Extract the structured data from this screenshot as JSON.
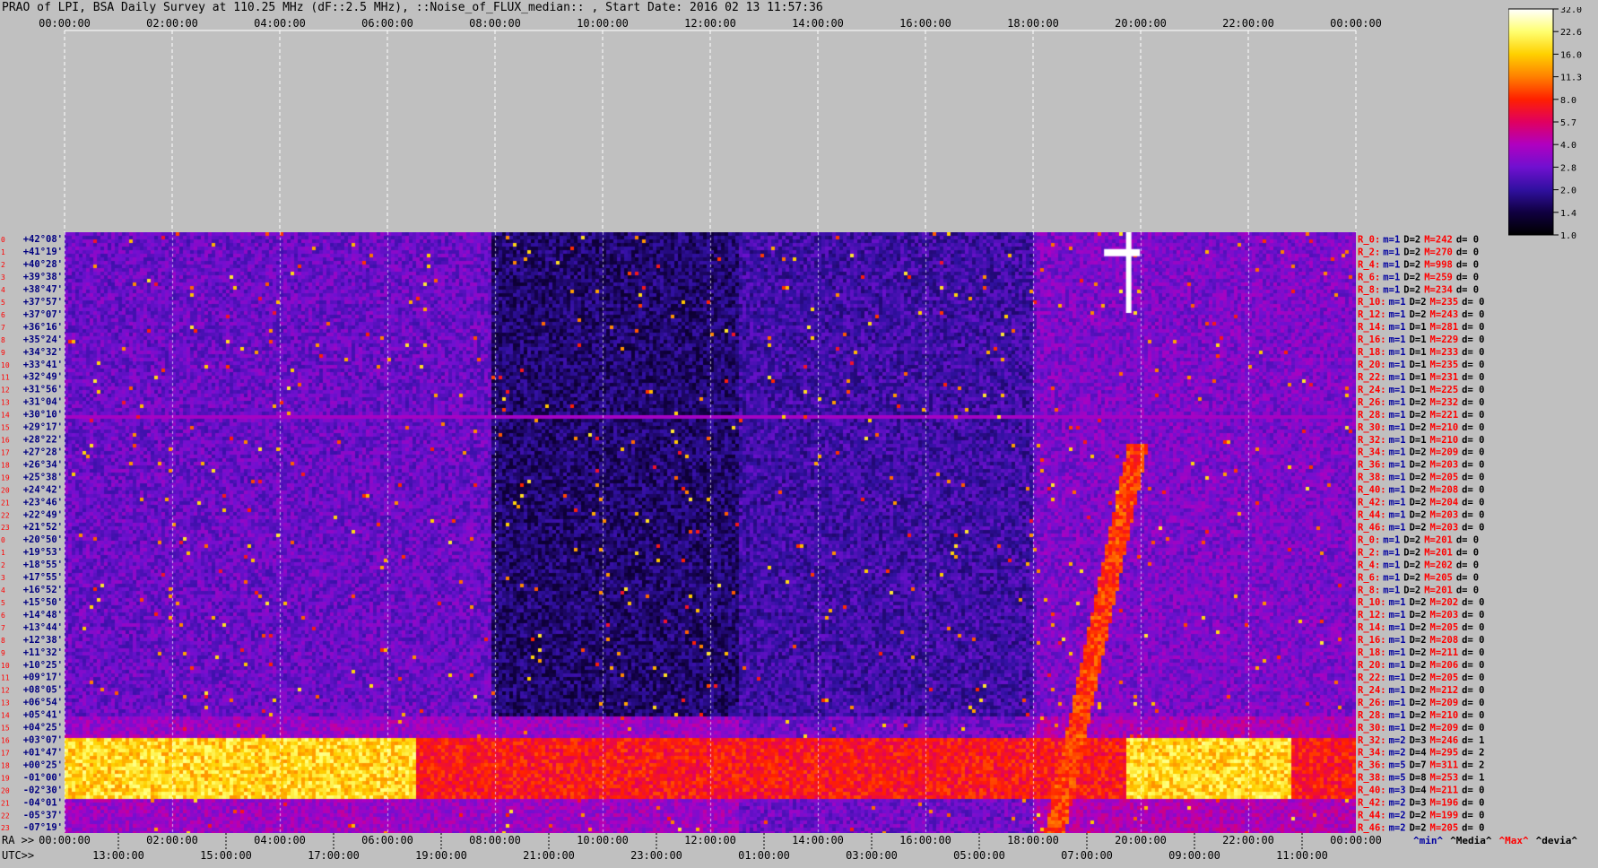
{
  "title": "PRAO of LPI, BSA Daily Survey at 110.25 MHz (dF::2.5 MHz), ::Noise_of_FLUX_median:: , Start Date: 2016 02 13 11:57:36",
  "chart_data": {
    "type": "heatmap",
    "title": "PRAO of LPI, BSA Daily Survey at 110.25 MHz (dF::2.5 MHz), ::Noise_of_FLUX_median:: , Start Date: 2016 02 13 11:57:36",
    "x_top_ticks": [
      "00:00:00",
      "02:00:00",
      "04:00:00",
      "06:00:00",
      "08:00:00",
      "10:00:00",
      "12:00:00",
      "14:00:00",
      "16:00:00",
      "18:00:00",
      "20:00:00",
      "22:00:00",
      "00:00:00"
    ],
    "x_bottom_ra_label": "RA >>",
    "x_bottom_ra_ticks": [
      "00:00:00",
      "02:00:00",
      "04:00:00",
      "06:00:00",
      "08:00:00",
      "10:00:00",
      "12:00:00",
      "14:00:00",
      "16:00:00",
      "18:00:00",
      "20:00:00",
      "22:00:00",
      "00:00:00"
    ],
    "x_bottom_utc_label": "UTC>>",
    "x_bottom_utc_ticks": [
      "13:00:00",
      "15:00:00",
      "17:00:00",
      "19:00:00",
      "21:00:00",
      "23:00:00",
      "01:00:00",
      "03:00:00",
      "05:00:00",
      "07:00:00",
      "09:00:00",
      "11:00:00"
    ],
    "y_declinations": [
      "+42°08'",
      "+41°19'",
      "+40°28'",
      "+39°38'",
      "+38°47'",
      "+37°57'",
      "+37°07'",
      "+36°16'",
      "+35°24'",
      "+34°32'",
      "+33°41'",
      "+32°49'",
      "+31°56'",
      "+31°04'",
      "+30°10'",
      "+29°17'",
      "+28°22'",
      "+27°28'",
      "+26°34'",
      "+25°38'",
      "+24°42'",
      "+23°46'",
      "+22°49'",
      "+21°52'",
      "+20°50'",
      "+19°53'",
      "+18°55'",
      "+17°55'",
      "+16°52'",
      "+15°50'",
      "+14°48'",
      "+13°44'",
      "+12°38'",
      "+11°32'",
      "+10°25'",
      "+09°17'",
      "+08°05'",
      "+06°54'",
      "+05°41'",
      "+04°25'",
      "+03°07'",
      "+01°47'",
      "+00°25'",
      "-01°00'",
      "-02°30'",
      "-04°01'",
      "-05°37'",
      "-07°19'"
    ],
    "beam_rows": [
      {
        "r": "R_0:",
        "m": "m=1",
        "D": "D=2",
        "M": "M=242",
        "d": "d= 0"
      },
      {
        "r": "R_2:",
        "m": "m=1",
        "D": "D=2",
        "M": "M=270",
        "d": "d= 0"
      },
      {
        "r": "R_4:",
        "m": "m=1",
        "D": "D=2",
        "M": "M=998",
        "d": "d= 0"
      },
      {
        "r": "R_6:",
        "m": "m=1",
        "D": "D=2",
        "M": "M=259",
        "d": "d= 0"
      },
      {
        "r": "R_8:",
        "m": "m=1",
        "D": "D=2",
        "M": "M=234",
        "d": "d= 0"
      },
      {
        "r": "R_10:",
        "m": "m=1",
        "D": "D=2",
        "M": "M=235",
        "d": "d= 0"
      },
      {
        "r": "R_12:",
        "m": "m=1",
        "D": "D=2",
        "M": "M=243",
        "d": "d= 0"
      },
      {
        "r": "R_14:",
        "m": "m=1",
        "D": "D=1",
        "M": "M=281",
        "d": "d= 0"
      },
      {
        "r": "R_16:",
        "m": "m=1",
        "D": "D=1",
        "M": "M=229",
        "d": "d= 0"
      },
      {
        "r": "R_18:",
        "m": "m=1",
        "D": "D=1",
        "M": "M=233",
        "d": "d= 0"
      },
      {
        "r": "R_20:",
        "m": "m=1",
        "D": "D=1",
        "M": "M=235",
        "d": "d= 0"
      },
      {
        "r": "R_22:",
        "m": "m=1",
        "D": "D=1",
        "M": "M=231",
        "d": "d= 0"
      },
      {
        "r": "R_24:",
        "m": "m=1",
        "D": "D=1",
        "M": "M=225",
        "d": "d= 0"
      },
      {
        "r": "R_26:",
        "m": "m=1",
        "D": "D=2",
        "M": "M=232",
        "d": "d= 0"
      },
      {
        "r": "R_28:",
        "m": "m=1",
        "D": "D=2",
        "M": "M=221",
        "d": "d= 0"
      },
      {
        "r": "R_30:",
        "m": "m=1",
        "D": "D=2",
        "M": "M=210",
        "d": "d= 0"
      },
      {
        "r": "R_32:",
        "m": "m=1",
        "D": "D=1",
        "M": "M=210",
        "d": "d= 0"
      },
      {
        "r": "R_34:",
        "m": "m=1",
        "D": "D=2",
        "M": "M=209",
        "d": "d= 0"
      },
      {
        "r": "R_36:",
        "m": "m=1",
        "D": "D=2",
        "M": "M=203",
        "d": "d= 0"
      },
      {
        "r": "R_38:",
        "m": "m=1",
        "D": "D=2",
        "M": "M=205",
        "d": "d= 0"
      },
      {
        "r": "R_40:",
        "m": "m=1",
        "D": "D=2",
        "M": "M=208",
        "d": "d= 0"
      },
      {
        "r": "R_42:",
        "m": "m=1",
        "D": "D=2",
        "M": "M=204",
        "d": "d= 0"
      },
      {
        "r": "R_44:",
        "m": "m=1",
        "D": "D=2",
        "M": "M=203",
        "d": "d= 0"
      },
      {
        "r": "R_46:",
        "m": "m=1",
        "D": "D=2",
        "M": "M=203",
        "d": "d= 0"
      },
      {
        "r": "R_0:",
        "m": "m=1",
        "D": "D=2",
        "M": "M=201",
        "d": "d= 0"
      },
      {
        "r": "R_2:",
        "m": "m=1",
        "D": "D=2",
        "M": "M=201",
        "d": "d= 0"
      },
      {
        "r": "R_4:",
        "m": "m=1",
        "D": "D=2",
        "M": "M=202",
        "d": "d= 0"
      },
      {
        "r": "R_6:",
        "m": "m=1",
        "D": "D=2",
        "M": "M=205",
        "d": "d= 0"
      },
      {
        "r": "R_8:",
        "m": "m=1",
        "D": "D=2",
        "M": "M=201",
        "d": "d= 0"
      },
      {
        "r": "R_10:",
        "m": "m=1",
        "D": "D=2",
        "M": "M=202",
        "d": "d= 0"
      },
      {
        "r": "R_12:",
        "m": "m=1",
        "D": "D=2",
        "M": "M=203",
        "d": "d= 0"
      },
      {
        "r": "R_14:",
        "m": "m=1",
        "D": "D=2",
        "M": "M=205",
        "d": "d= 0"
      },
      {
        "r": "R_16:",
        "m": "m=1",
        "D": "D=2",
        "M": "M=208",
        "d": "d= 0"
      },
      {
        "r": "R_18:",
        "m": "m=1",
        "D": "D=2",
        "M": "M=211",
        "d": "d= 0"
      },
      {
        "r": "R_20:",
        "m": "m=1",
        "D": "D=2",
        "M": "M=206",
        "d": "d= 0"
      },
      {
        "r": "R_22:",
        "m": "m=1",
        "D": "D=2",
        "M": "M=205",
        "d": "d= 0"
      },
      {
        "r": "R_24:",
        "m": "m=1",
        "D": "D=2",
        "M": "M=212",
        "d": "d= 0"
      },
      {
        "r": "R_26:",
        "m": "m=1",
        "D": "D=2",
        "M": "M=209",
        "d": "d= 0"
      },
      {
        "r": "R_28:",
        "m": "m=1",
        "D": "D=2",
        "M": "M=210",
        "d": "d= 0"
      },
      {
        "r": "R_30:",
        "m": "m=1",
        "D": "D=2",
        "M": "M=209",
        "d": "d= 0"
      },
      {
        "r": "R_32:",
        "m": "m=2",
        "D": "D=3",
        "M": "M=246",
        "d": "d= 1"
      },
      {
        "r": "R_34:",
        "m": "m=2",
        "D": "D=4",
        "M": "M=295",
        "d": "d= 2"
      },
      {
        "r": "R_36:",
        "m": "m=5",
        "D": "D=7",
        "M": "M=311",
        "d": "d= 2"
      },
      {
        "r": "R_38:",
        "m": "m=5",
        "D": "D=8",
        "M": "M=253",
        "d": "d= 1"
      },
      {
        "r": "R_40:",
        "m": "m=3",
        "D": "D=4",
        "M": "M=211",
        "d": "d= 0"
      },
      {
        "r": "R_42:",
        "m": "m=2",
        "D": "D=3",
        "M": "M=196",
        "d": "d= 0"
      },
      {
        "r": "R_44:",
        "m": "m=2",
        "D": "D=2",
        "M": "M=199",
        "d": "d= 0"
      },
      {
        "r": "R_46:",
        "m": "m=2",
        "D": "D=2",
        "M": "M=205",
        "d": "d= 0"
      }
    ],
    "summary_labels": {
      "min": "^min^",
      "median": "^Media^",
      "max": "^Max^",
      "dev": "^devia^"
    },
    "colorbar": {
      "ticks": [
        "32.0",
        "22.6",
        "16.0",
        "11.3",
        "8.0",
        "5.7",
        "4.0",
        "2.8",
        "2.0",
        "1.4",
        "1.0"
      ],
      "colors": [
        "#ffffff",
        "#ffff70",
        "#ffd000",
        "#ff8000",
        "#ff2000",
        "#e00060",
        "#b000c0",
        "#7010d0",
        "#3010a0",
        "#100040",
        "#000000"
      ]
    },
    "colors": {
      "background": "#c0c0c0",
      "beam_label": "#ff0000",
      "max_label": "#ff0000",
      "min_label": "#0000a0",
      "grid": "#ffffff"
    }
  }
}
